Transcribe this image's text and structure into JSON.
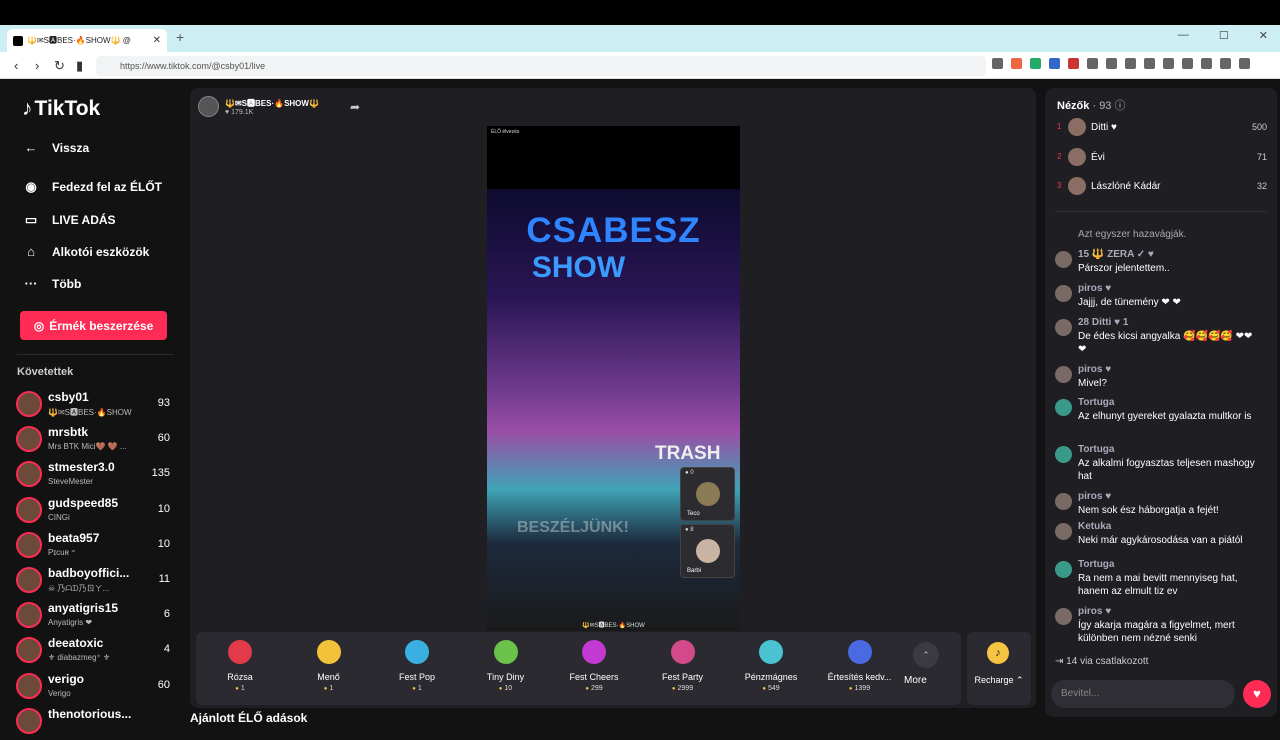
{
  "browser": {
    "tab_title": "🔱✉S🅰BES·🔥SHOW🔱 @",
    "url": "https://www.tiktok.com/@csby01/live"
  },
  "sidebar": {
    "logo": "TikTok",
    "back": "Vissza",
    "items": [
      "Fedezd fel az ÉLŐT",
      "LIVE ADÁS",
      "Alkotói eszközök",
      "Több"
    ],
    "coins_button": "Érmék beszerzése",
    "following_header": "Követettek",
    "following": [
      {
        "name": "csby01",
        "sub": "🔱✉S🅰BES·🔥SHOW",
        "count": "93"
      },
      {
        "name": "mrsbtk",
        "sub": "Mrs BTK Mici🤎 🤎 ...",
        "count": "60"
      },
      {
        "name": "stmester3.0",
        "sub": "SteveMester",
        "count": "135"
      },
      {
        "name": "gudspeed85",
        "sub": "CINGi",
        "count": "10"
      },
      {
        "name": "beata957",
        "sub": "Pɪcuʀ ⁼",
        "count": "10"
      },
      {
        "name": "badboyoffici...",
        "sub": "☠ 乃ᗩᗪ乃ㄖㄚ...",
        "count": "11"
      },
      {
        "name": "anyatigris15",
        "sub": "Anyatigris ❤",
        "count": "6"
      },
      {
        "name": "deeatoxic",
        "sub": "⚜ diabazmeg⁺ ⚜",
        "count": "4"
      },
      {
        "name": "verigo",
        "sub": "Verigo",
        "count": "60"
      },
      {
        "name": "thenotorious...",
        "sub": "",
        "count": ""
      }
    ]
  },
  "main": {
    "host_name": "🔱✉S🅰BES·🔥SHOW🔱",
    "host_likes": "179.1K",
    "video_label": "ÉLŐ élvezés",
    "video_title1": "CSABESZ",
    "video_title2": "SHOW",
    "video_trash": "TRASH",
    "video_watermark": "BESZÉLJÜNK!",
    "video_bottom": "🔱✉S🅰BES·🔥SHOW",
    "guests": [
      {
        "count": "0",
        "name": "Teco"
      },
      {
        "count": "8",
        "name": "Barbi"
      }
    ],
    "gifts": [
      {
        "name": "Rózsa",
        "price": "1",
        "color": "#e23a4a"
      },
      {
        "name": "Menő",
        "price": "1",
        "color": "#f2c23a"
      },
      {
        "name": "Fest Pop",
        "price": "1",
        "color": "#3ab0e2"
      },
      {
        "name": "Tiny Diny",
        "price": "10",
        "color": "#6ac24a"
      },
      {
        "name": "Fest Cheers",
        "price": "299",
        "color": "#c23ad2"
      },
      {
        "name": "Fest Party",
        "price": "2999",
        "color": "#d24a8a"
      },
      {
        "name": "Pénzmágnes",
        "price": "549",
        "color": "#4ac2d2"
      },
      {
        "name": "Értesítés kedv...",
        "price": "1399",
        "color": "#4a6ae2"
      }
    ],
    "more": "More",
    "recharge": "Recharge",
    "below_title": "Ajánlott ÉLŐ adások"
  },
  "chat": {
    "viewers_title": "Nézők",
    "viewers_count": "· 93",
    "top": [
      {
        "rank": "1",
        "name": "Ditti ♥",
        "score": "500"
      },
      {
        "rank": "2",
        "name": "Évi",
        "score": "71"
      },
      {
        "rank": "3",
        "name": "Lászlóné Kádár",
        "score": "32"
      }
    ],
    "messages": [
      {
        "user": "",
        "text": "Azt egyszer hazavágják."
      },
      {
        "user": "15 🔱 ZERA ✓ ♥",
        "text": "Párszor jelentettem.."
      },
      {
        "user": "piros ♥",
        "text": "Jajjj, de tünemény ❤ ❤"
      },
      {
        "user": "28 Ditti ♥ 1",
        "text": "De édes kicsi angyalka 🥰🥰🥰🥰 ❤❤❤"
      },
      {
        "user": "piros ♥",
        "text": "Mivel?"
      },
      {
        "user": "Tortuga",
        "text": "Az elhunyt gyereket gyalazta multkor is"
      },
      {
        "user": "Tortuga",
        "text": "Az alkalmi fogyasztas teljesen mashogy hat"
      },
      {
        "user": "piros ♥",
        "text": "Nem sok ész háborgatja a fejét!"
      },
      {
        "user": "Ketuka",
        "text": "Neki már agykárosodása van a piától"
      },
      {
        "user": "Tortuga",
        "text": "Ra nem a mai bevitt mennyiseg hat, hanem az elmult tiz ev"
      },
      {
        "user": "piros ♥",
        "text": "Így akarja magára a figyelmet, mert különben nem nézné senki"
      }
    ],
    "join": "14 via csatlakozott",
    "input_placeholder": "Bevitel..."
  }
}
